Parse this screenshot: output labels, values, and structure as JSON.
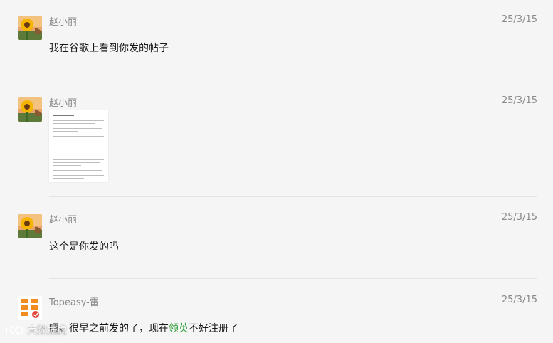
{
  "messages": [
    {
      "sender": "赵小丽",
      "date": "25/3/15",
      "text": "我在谷歌上看到你发的帖子"
    },
    {
      "sender": "赵小丽",
      "date": "25/3/15",
      "attachment": "document-image"
    },
    {
      "sender": "赵小丽",
      "date": "25/3/15",
      "text": "这个是你发的吗"
    },
    {
      "sender": "Topeasy-雷",
      "date": "25/3/15",
      "text_before": "嗯，很早之前发的了，现在",
      "text_highlight": "领英",
      "text_after": "不好注册了"
    }
  ],
  "watermark": {
    "text": "大数据虎"
  },
  "colors": {
    "background": "#f5f5f5",
    "meta_text": "#8a8a8a",
    "body_text": "#191919",
    "highlight": "#2e9e3a"
  },
  "icons": [
    "sunflower-avatar-icon",
    "topeasy-logo-icon",
    "watermark-logo-icon"
  ]
}
